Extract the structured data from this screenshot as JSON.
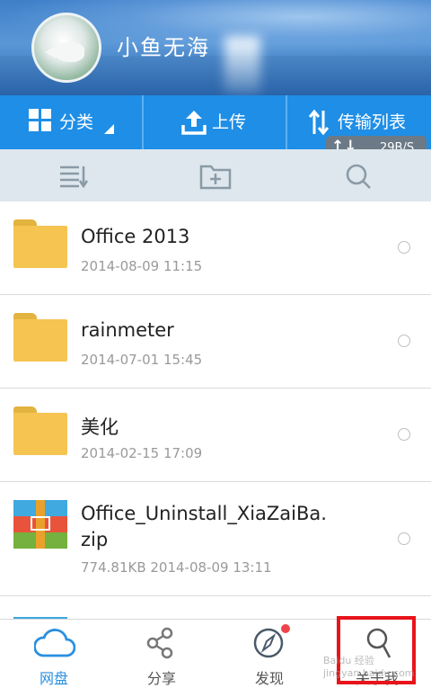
{
  "header": {
    "username": "小鱼无海"
  },
  "tabs": [
    {
      "label": "分类",
      "icon": "grid-icon"
    },
    {
      "label": "上传",
      "icon": "upload-icon"
    },
    {
      "label": "传输列表",
      "icon": "transfer-icon"
    }
  ],
  "speed": {
    "arrows": "↑↓",
    "rate": "29B/S"
  },
  "toolbar": {
    "icons": [
      "sort-list-icon",
      "new-folder-icon",
      "search-icon"
    ]
  },
  "files": [
    {
      "name": "Office 2013",
      "meta": "2014-08-09  11:15",
      "type": "folder"
    },
    {
      "name": "rainmeter",
      "meta": "2014-07-01  15:45",
      "type": "folder"
    },
    {
      "name": "美化",
      "meta": "2014-02-15  17:09",
      "type": "folder"
    },
    {
      "name": "Office_Uninstall_XiaZaiBa.",
      "name2": "zip",
      "meta": "774.81KB  2014-08-09  13:11",
      "type": "zip"
    }
  ],
  "nav": [
    {
      "label": "网盘",
      "icon": "cloud-icon",
      "active": true
    },
    {
      "label": "分享",
      "icon": "share-icon",
      "active": false
    },
    {
      "label": "发现",
      "icon": "compass-icon",
      "active": false
    },
    {
      "label": "关于我",
      "icon": "user-icon",
      "active": false
    }
  ],
  "watermark": "Baidu 经验 jingyan.baidu.com",
  "colors": {
    "accent": "#1f8ee6",
    "folder": "#f5c451",
    "highlight": "#e8141a",
    "badge": "#f0444a"
  }
}
